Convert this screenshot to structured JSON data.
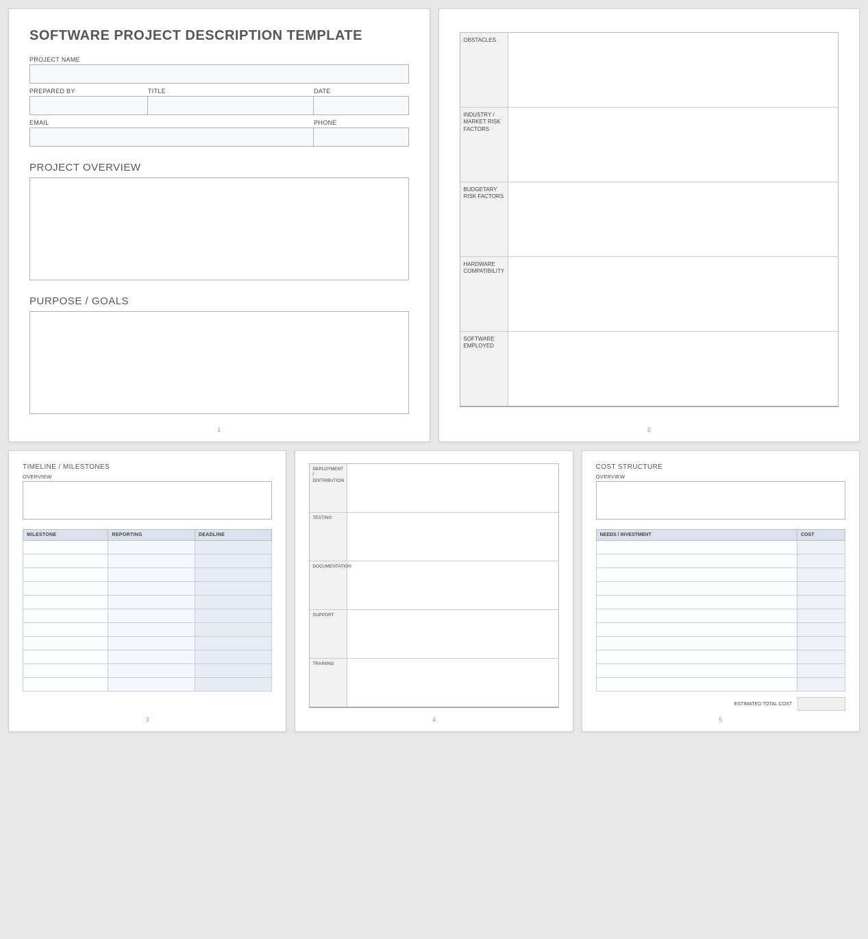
{
  "page1": {
    "title": "SOFTWARE PROJECT DESCRIPTION TEMPLATE",
    "labels": {
      "project_name": "PROJECT NAME",
      "prepared_by": "PREPARED BY",
      "title": "TITLE",
      "date": "DATE",
      "email": "EMAIL",
      "phone": "PHONE"
    },
    "sections": {
      "overview": "PROJECT OVERVIEW",
      "purpose": "PURPOSE / GOALS"
    },
    "page_num": "1"
  },
  "page2": {
    "rows": [
      "OBSTACLES",
      "INDUSTRY / MARKET RISK FACTORS",
      "BUDGETARY RISK FACTORS",
      "HARDWARE COMPATIBILITY",
      "SOFTWARE EMPLOYED"
    ],
    "page_num": "2"
  },
  "page3": {
    "heading": "TIMELINE / MILESTONES",
    "overview_label": "OVERVIEW",
    "columns": [
      "MILESTONE",
      "REPORTING",
      "DEADLINE"
    ],
    "row_count": 11,
    "page_num": "3"
  },
  "page4": {
    "rows": [
      "DEPLOYMENT / DISTRIBUTION",
      "TESTING",
      "DOCUMENTATION",
      "SUPPORT",
      "TRAINING"
    ],
    "page_num": "4"
  },
  "page5": {
    "heading": "COST STRUCTURE",
    "overview_label": "OVERVIEW",
    "columns": [
      "NEEDS / INVESTMENT",
      "COST"
    ],
    "row_count": 11,
    "total_label": "ESTIMATED TOTAL COST",
    "page_num": "5"
  }
}
